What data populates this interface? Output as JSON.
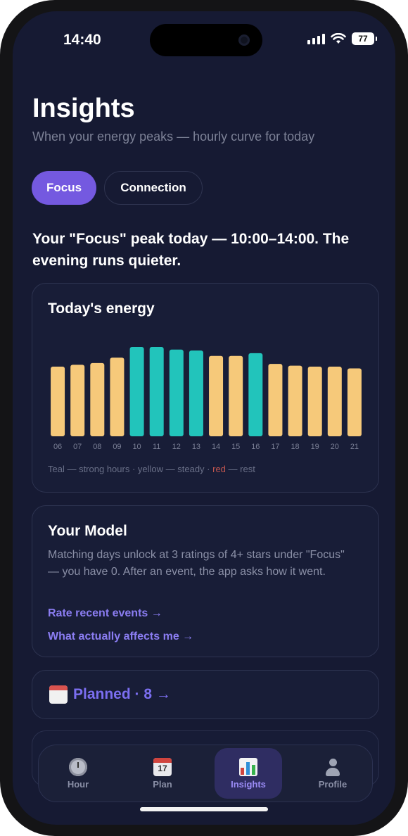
{
  "status_bar": {
    "time": "14:40",
    "battery": "77"
  },
  "header": {
    "title": "Insights",
    "subtitle": "When your energy peaks — hourly curve for today"
  },
  "chips": {
    "focus": "Focus",
    "connection": "Connection",
    "active": "Focus"
  },
  "peak_text": "Your \"Focus\" peak today — 10:00–14:00. The evening runs quieter.",
  "energy_card": {
    "title": "Today's energy",
    "legend": {
      "teal": "Teal — strong hours",
      "sep1": " · ",
      "yellow": "yellow — steady",
      "sep2": " · ",
      "red": "red",
      "rest": " — rest"
    }
  },
  "chart_data": {
    "type": "bar",
    "categories": [
      "06",
      "07",
      "08",
      "09",
      "10",
      "11",
      "12",
      "13",
      "14",
      "15",
      "16",
      "17",
      "18",
      "19",
      "20",
      "21"
    ],
    "values": [
      0.78,
      0.8,
      0.82,
      0.88,
      1.0,
      1.0,
      0.97,
      0.96,
      0.9,
      0.9,
      0.93,
      0.81,
      0.79,
      0.78,
      0.78,
      0.76
    ],
    "levels": [
      "yellow",
      "yellow",
      "yellow",
      "yellow",
      "teal",
      "teal",
      "teal",
      "teal",
      "yellow",
      "yellow",
      "teal",
      "yellow",
      "yellow",
      "yellow",
      "yellow",
      "yellow"
    ],
    "colors": {
      "teal": "#22c4bb",
      "yellow": "#f6c97a",
      "red": "#c2564f"
    },
    "title": "Today's energy",
    "ylim": [
      0,
      1
    ],
    "grid": false
  },
  "model_card": {
    "title": "Your Model",
    "description": "Matching days unlock at 3 ratings of 4+ stars under \"Focus\" — you have 0. After an event, the app asks how it went.",
    "link_rate": "Rate recent events →",
    "link_affects": "What actually affects me →"
  },
  "planned": {
    "label": "Planned · 8 →",
    "icon": "calendar-emoji"
  },
  "tabbar": {
    "tabs": [
      {
        "label": "Hour",
        "icon": "clock-icon"
      },
      {
        "label": "Plan",
        "icon": "calendar-icon",
        "day": "17"
      },
      {
        "label": "Insights",
        "icon": "bar-chart-icon"
      },
      {
        "label": "Profile",
        "icon": "user-icon"
      }
    ],
    "active": "Insights"
  },
  "theme": {
    "background": "#161a33",
    "accent": "#7459e0",
    "link": "#8b7df2"
  }
}
